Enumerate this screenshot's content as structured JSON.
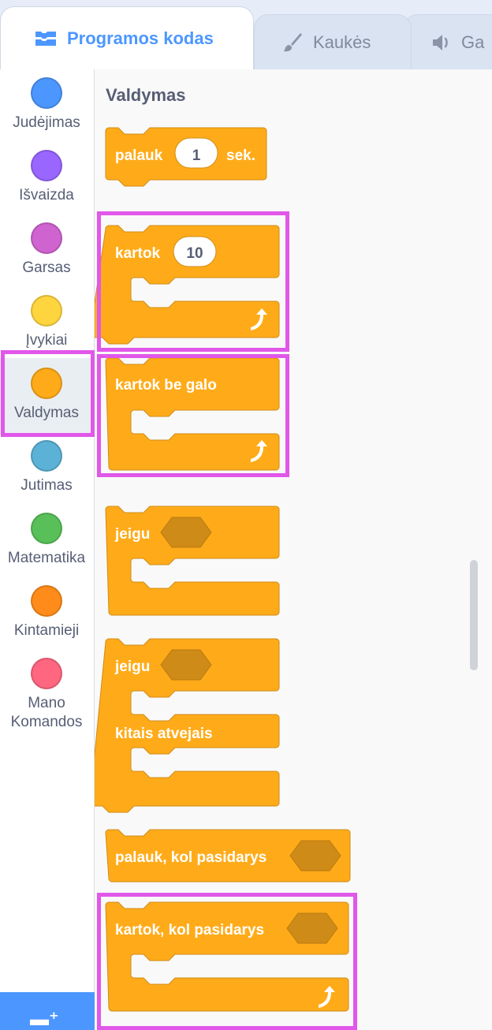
{
  "tabs": [
    {
      "label": "Programos kodas",
      "icon": "code-blocks-icon",
      "active": true
    },
    {
      "label": "Kaukės",
      "icon": "paintbrush-icon",
      "active": false
    },
    {
      "label": "Ga",
      "icon": "speaker-icon",
      "active": false
    }
  ],
  "categories": [
    {
      "label": "Judėjimas",
      "color": "#4c97ff"
    },
    {
      "label": "Išvaizda",
      "color": "#9966ff"
    },
    {
      "label": "Garsas",
      "color": "#cf63cf"
    },
    {
      "label": "Įvykiai",
      "color": "#ffd500"
    },
    {
      "label": "Valdymas",
      "color": "#ffab19",
      "selected": true
    },
    {
      "label": "Jutimas",
      "color": "#5cb1d6"
    },
    {
      "label": "Matematika",
      "color": "#59c059"
    },
    {
      "label": "Kintamieji",
      "color": "#ff8c1a"
    },
    {
      "label": "Mano Komandos",
      "color": "#ff6680"
    }
  ],
  "palette": {
    "section_title": "Valdymas",
    "blocks": {
      "wait": {
        "label": "palauk",
        "value": "1",
        "suffix": "sek."
      },
      "repeat": {
        "label": "kartok",
        "value": "10"
      },
      "forever": {
        "label": "kartok be galo"
      },
      "if_then": {
        "label": "jeigu"
      },
      "if_else": {
        "label": "jeigu",
        "else_label": "kitais atvejais"
      },
      "wait_until": {
        "label": "palauk, kol pasidarys"
      },
      "repeat_until": {
        "label": "kartok, kol pasidarys"
      }
    }
  },
  "colors": {
    "control": "#ffab19",
    "control_border": "#cf8b17",
    "highlight": "#e157e9",
    "accent": "#4c97ff"
  }
}
